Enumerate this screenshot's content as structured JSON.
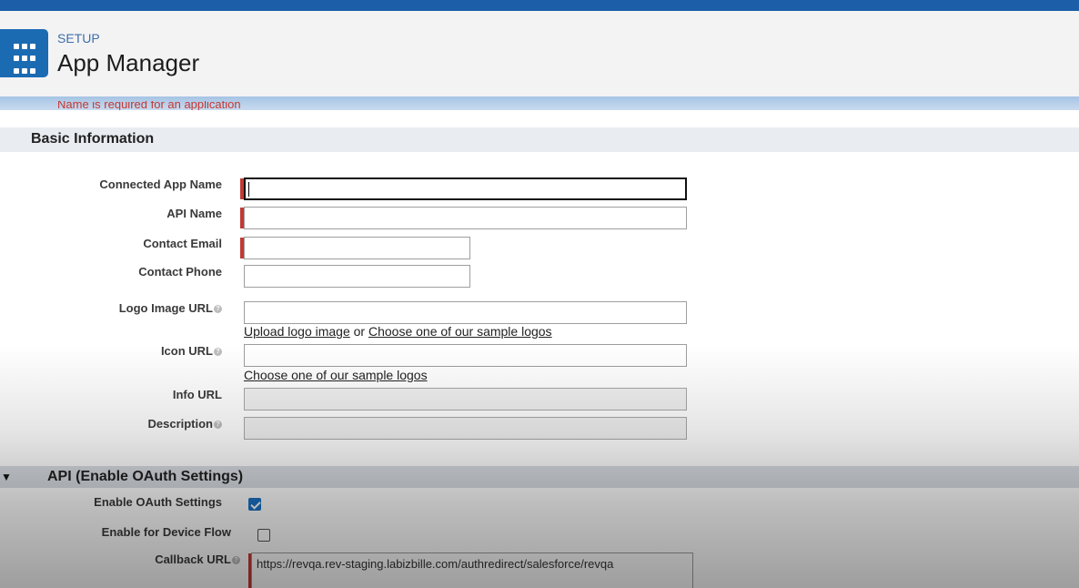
{
  "header": {
    "eyebrow": "SETUP",
    "title": "App Manager",
    "app_icon": "app-launcher-grid-icon"
  },
  "error_message": "Name is required for an application",
  "basic_info": {
    "title": "Basic Information",
    "fields": {
      "connected_app_name": {
        "label": "Connected App Name",
        "value": "",
        "required": true
      },
      "api_name": {
        "label": "API Name",
        "value": "",
        "required": true
      },
      "contact_email": {
        "label": "Contact Email",
        "value": "",
        "required": true
      },
      "contact_phone": {
        "label": "Contact Phone",
        "value": "",
        "required": false
      },
      "logo_image_url": {
        "label": "Logo Image URL",
        "value": "",
        "help": true
      },
      "icon_url": {
        "label": "Icon URL",
        "value": "",
        "help": true
      },
      "info_url": {
        "label": "Info URL",
        "value": ""
      },
      "description": {
        "label": "Description",
        "value": "",
        "help": true
      }
    },
    "logo_links": {
      "upload": "Upload logo image",
      "or": "or",
      "choose": "Choose one of our sample logos"
    },
    "icon_links": {
      "choose": "Choose one of our sample logos"
    }
  },
  "api_section": {
    "title": "API (Enable OAuth Settings)",
    "enable_oauth": {
      "label": "Enable OAuth Settings",
      "checked": true
    },
    "device_flow": {
      "label": "Enable for Device Flow",
      "checked": false
    },
    "callback_url": {
      "label": "Callback URL",
      "value": "https://revqa.rev-staging.labizbille.com/authredirect/salesforce/revqa",
      "required": true
    }
  },
  "colors": {
    "brand_blue": "#1b6bb3",
    "required_red": "#c23934",
    "checkbox_blue": "#1a73c8"
  }
}
